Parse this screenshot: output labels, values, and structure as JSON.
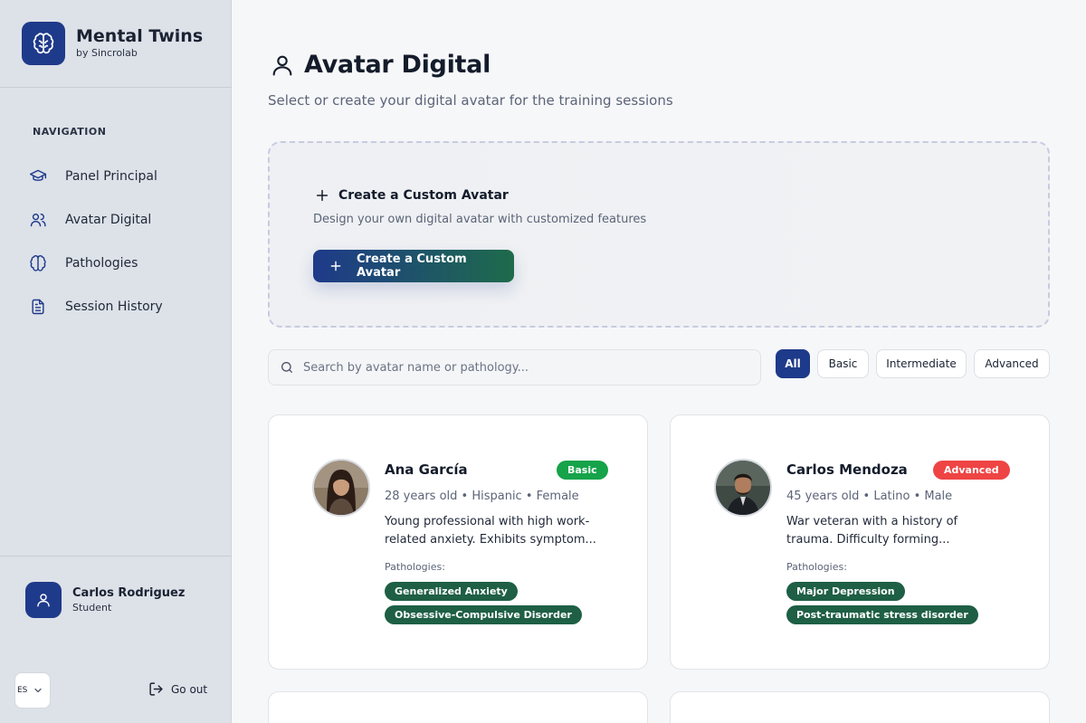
{
  "app": {
    "title": "Mental Twins",
    "subtitle": "by Sincrolab"
  },
  "sidebar": {
    "nav_heading": "NAVIGATION",
    "items": [
      {
        "label": "Panel Principal",
        "icon": "graduation-cap-icon"
      },
      {
        "label": "Avatar Digital",
        "icon": "users-icon"
      },
      {
        "label": "Pathologies",
        "icon": "brain-icon"
      },
      {
        "label": "Session History",
        "icon": "document-icon"
      }
    ],
    "user": {
      "name": "Carlos Rodriguez",
      "role": "Student"
    },
    "language": "ES",
    "logout_label": "Go out"
  },
  "page": {
    "title": "Avatar Digital",
    "subtitle": "Select or create your digital avatar for the training sessions"
  },
  "create_card": {
    "title": "Create a Custom Avatar",
    "description": "Design your own digital avatar with customized features",
    "button_label": "Create a Custom Avatar"
  },
  "search": {
    "placeholder": "Search by avatar name or pathology...",
    "value": ""
  },
  "filters": [
    {
      "label": "All",
      "active": true
    },
    {
      "label": "Basic",
      "active": false
    },
    {
      "label": "Intermediate",
      "active": false
    },
    {
      "label": "Advanced",
      "active": false
    }
  ],
  "avatars": [
    {
      "name": "Ana García",
      "level": "Basic",
      "level_color": "#16a34a",
      "meta": "28 years old • Hispanic • Female",
      "description_lines": [
        "Young professional with high work-",
        "related anxiety. Exhibits symptom..."
      ],
      "pathologies_label": "Pathologies:",
      "pathologies": [
        "Generalized Anxiety",
        "Obsessive-Compulsive Disorder"
      ]
    },
    {
      "name": "Carlos Mendoza",
      "level": "Advanced",
      "level_color": "#ef4444",
      "meta": "45 years old • Latino • Male",
      "description_lines": [
        "War veteran with a history of",
        "trauma. Difficulty forming..."
      ],
      "pathologies_label": "Pathologies:",
      "pathologies": [
        "Major Depression",
        "Post-traumatic stress disorder"
      ]
    }
  ],
  "colors": {
    "primary": "#1e3a8a",
    "accent_green": "#1e5f45",
    "sidebar_bg": "#dde1e8"
  }
}
